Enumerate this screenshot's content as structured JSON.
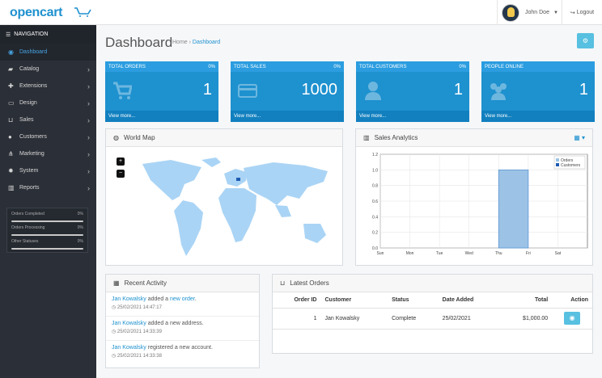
{
  "header": {
    "logo": "opencart",
    "user_name": "John Doe",
    "logout": "Logout"
  },
  "sidebar": {
    "title": "NAVIGATION",
    "items": [
      {
        "label": "Dashboard",
        "icon": "dashboard-icon"
      },
      {
        "label": "Catalog",
        "icon": "tag-icon"
      },
      {
        "label": "Extensions",
        "icon": "puzzle-icon"
      },
      {
        "label": "Design",
        "icon": "monitor-icon"
      },
      {
        "label": "Sales",
        "icon": "cart-icon"
      },
      {
        "label": "Customers",
        "icon": "user-icon"
      },
      {
        "label": "Marketing",
        "icon": "share-icon"
      },
      {
        "label": "System",
        "icon": "gear-icon"
      },
      {
        "label": "Reports",
        "icon": "bar-chart-icon"
      }
    ],
    "stats": [
      {
        "label": "Orders Completed",
        "value": "0%",
        "progress": 0
      },
      {
        "label": "Orders Processing",
        "value": "0%",
        "progress": 0
      },
      {
        "label": "Other Statuses",
        "value": "0%",
        "progress": 0
      }
    ]
  },
  "page": {
    "title": "Dashboard",
    "breadcrumb": [
      "Home",
      "Dashboard"
    ]
  },
  "tiles": [
    {
      "title": "TOTAL ORDERS",
      "percent": "0%",
      "value": "1",
      "footer": "View more...",
      "icon": "cart-icon"
    },
    {
      "title": "TOTAL SALES",
      "percent": "0%",
      "value": "1000",
      "footer": "View more...",
      "icon": "credit-card-icon"
    },
    {
      "title": "TOTAL CUSTOMERS",
      "percent": "0%",
      "value": "1",
      "footer": "View more...",
      "icon": "user-icon"
    },
    {
      "title": "PEOPLE ONLINE",
      "percent": "",
      "value": "1",
      "footer": "View more...",
      "icon": "users-icon"
    }
  ],
  "world_map": {
    "title": "World Map",
    "zoom_in": "+",
    "zoom_out": "−"
  },
  "sales_analytics": {
    "title": "Sales Analytics",
    "calendar_icon": "calendar-icon"
  },
  "recent_activity": {
    "title": "Recent Activity",
    "items": [
      {
        "actor": "Jan Kowalsky",
        "middle": " added a ",
        "object": "new order",
        "suffix": ".",
        "time": "25/02/2021 14:47:17"
      },
      {
        "actor": "Jan Kowalsky",
        "middle": " added a new address.",
        "object": "",
        "suffix": "",
        "time": "25/02/2021 14:33:39"
      },
      {
        "actor": "Jan Kowalsky",
        "middle": " registered a new account.",
        "object": "",
        "suffix": "",
        "time": "25/02/2021 14:33:38"
      }
    ]
  },
  "latest_orders": {
    "title": "Latest Orders",
    "columns": [
      "Order ID",
      "Customer",
      "Status",
      "Date Added",
      "Total",
      "Action"
    ],
    "rows": [
      {
        "order_id": "1",
        "customer": "Jan Kowalsky",
        "status": "Complete",
        "date_added": "25/02/2021",
        "total": "$1,000.00"
      }
    ]
  },
  "chart_data": {
    "type": "bar",
    "categories": [
      "Sun",
      "Mon",
      "Tue",
      "Wed",
      "Thu",
      "Fri",
      "Sat"
    ],
    "series": [
      {
        "name": "Orders",
        "values": [
          0,
          0,
          0,
          0,
          1,
          0,
          0
        ],
        "color": "#9cc3e5"
      },
      {
        "name": "Customers",
        "values": [
          0,
          0,
          0,
          0,
          0,
          0,
          0
        ],
        "color": "#1e5cb3"
      }
    ],
    "yticks": [
      "0.0",
      "0.2",
      "0.4",
      "0.6",
      "0.8",
      "1.0",
      "1.2"
    ],
    "ylim": [
      0,
      1.2
    ],
    "legend": "top-right",
    "grid": true
  },
  "colors": {
    "accent": "#1e91cf",
    "sidebar": "#2b2f37",
    "tile": "#1e91cf",
    "button": "#58c0e0"
  }
}
